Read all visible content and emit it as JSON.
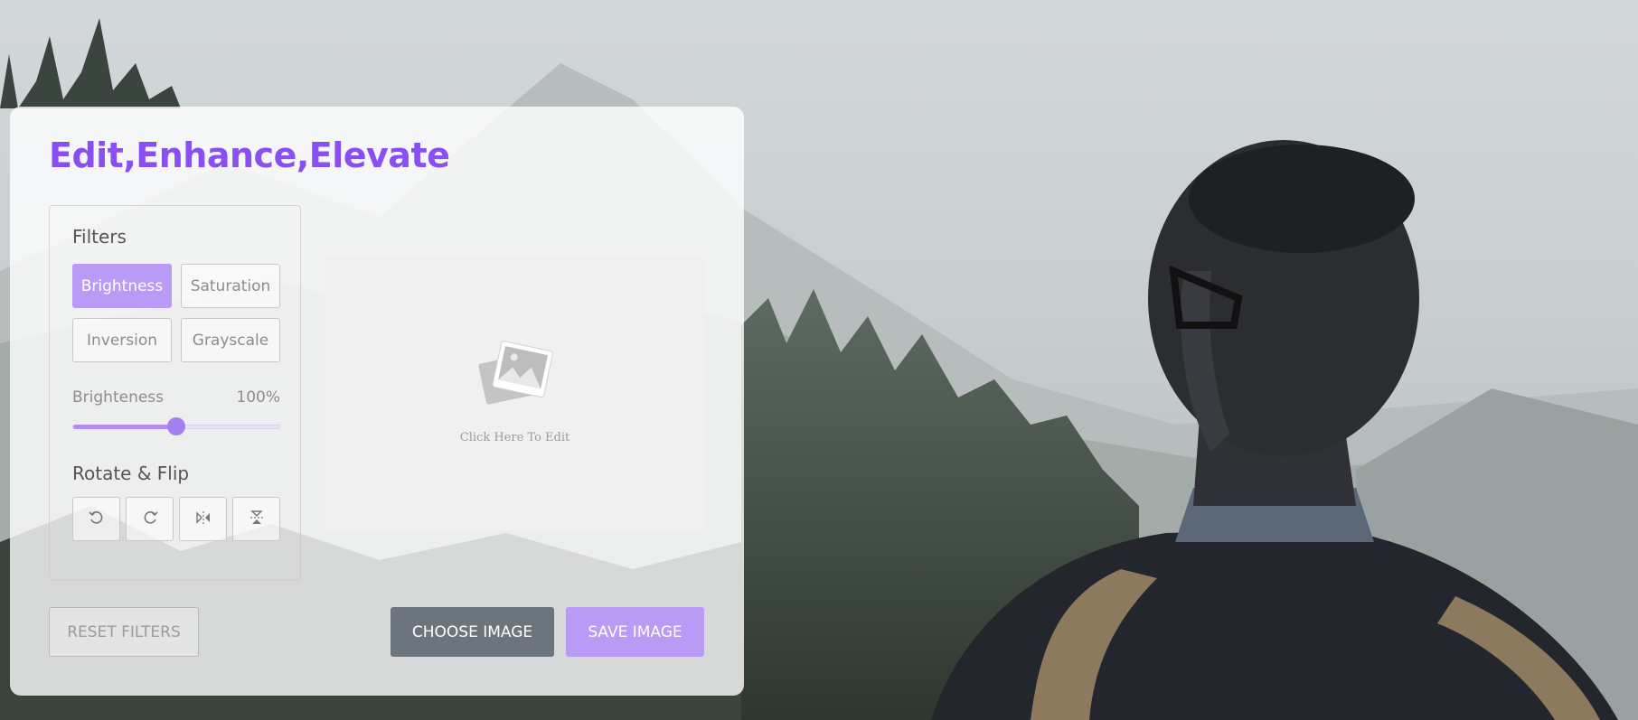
{
  "app": {
    "title": "Edit,Enhance,Elevate"
  },
  "filters": {
    "heading": "Filters",
    "options": [
      {
        "label": "Brightness",
        "active": true
      },
      {
        "label": "Saturation",
        "active": false
      },
      {
        "label": "Inversion",
        "active": false
      },
      {
        "label": "Grayscale",
        "active": false
      }
    ],
    "slider": {
      "name": "Brighteness",
      "value_text": "100%",
      "fraction": 0.5
    }
  },
  "rotate_flip": {
    "heading": "Rotate & Flip",
    "buttons": [
      {
        "icon": "rotate-left-icon"
      },
      {
        "icon": "rotate-right-icon"
      },
      {
        "icon": "flip-horizontal-icon"
      },
      {
        "icon": "flip-vertical-icon"
      }
    ]
  },
  "preview": {
    "icon": "image-placeholder-icon",
    "text": "Click Here To Edit"
  },
  "actions": {
    "reset": "RESET FILTERS",
    "choose": "CHOOSE IMAGE",
    "save": "SAVE IMAGE"
  },
  "colors": {
    "accent": "#8a4ff0",
    "active_button": "#b99af5",
    "choose_button": "#6c757d"
  }
}
